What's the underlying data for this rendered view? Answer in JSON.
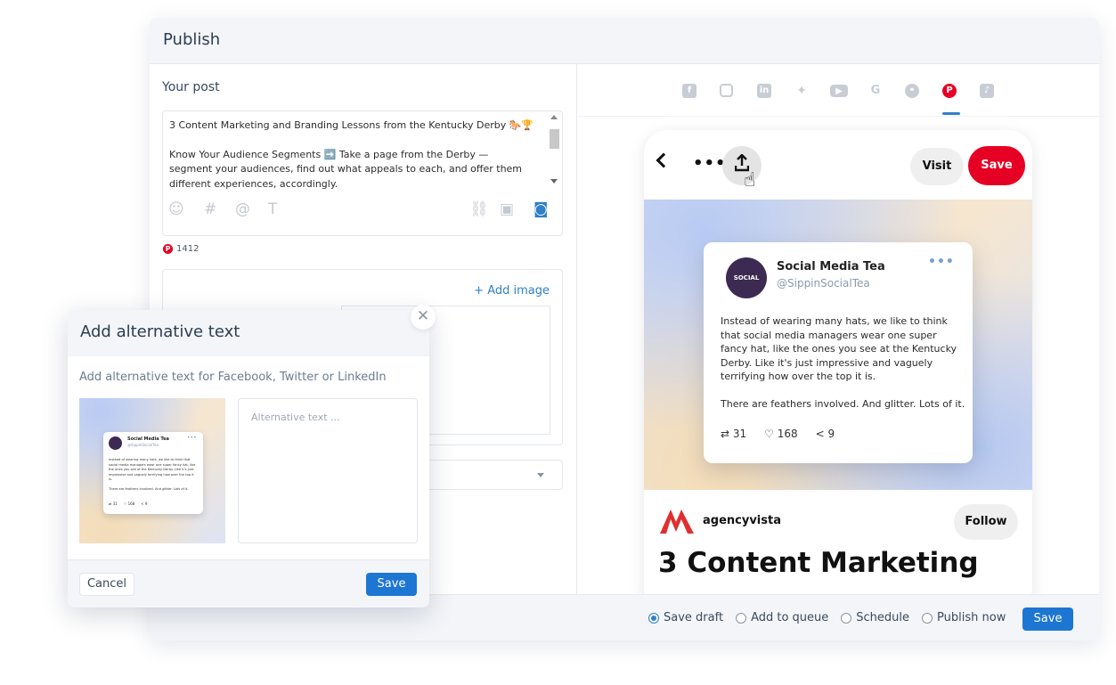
{
  "publish": {
    "title": "Publish",
    "your_post_label": "Your post",
    "editor": {
      "line1": "3 Content Marketing and Branding Lessons from the Kentucky Derby 🐎🏆",
      "line2": "Know Your Audience Segments ➡️ Take a page from the Derby — segment your audiences, find out what appeals to each, and offer them different experiences, accordingly.",
      "tools": [
        "emoji-icon",
        "hashtag-icon",
        "mention-icon",
        "text-format-icon",
        "link-icon",
        "video-icon",
        "camera-icon"
      ]
    },
    "pinterest_char_count": "1412",
    "add_image_label": "+ Add image"
  },
  "social_tabs": [
    "facebook-icon",
    "instagram-icon",
    "linkedin-icon",
    "twitter-icon",
    "youtube-icon",
    "google-icon",
    "reddit-icon",
    "pinterest-icon",
    "tiktok-icon"
  ],
  "active_social_tab": "pinterest-icon",
  "preview": {
    "visit_label": "Visit",
    "save_label": "Save",
    "tweet": {
      "avatar_text": "SOCIAL MEDIA TEA",
      "name": "Social Media Tea",
      "handle": "@SippinSocialTea",
      "para1": "Instead of wearing many hats, we like to think that social media managers wear one super fancy hat, like the ones you see at the Kentucky Derby. Like it's just impressive and vaguely terrifying how over the top it is.",
      "para2": "There are feathers involved. And glitter. Lots of it.",
      "retweets": "31",
      "likes": "168",
      "shares": "9"
    },
    "author": "agencyvista",
    "follow_label": "Follow",
    "headline": "3 Content Marketing"
  },
  "footer": {
    "options": [
      "Save draft",
      "Add to queue",
      "Schedule",
      "Publish now"
    ],
    "selected_option": "Save draft",
    "save_label": "Save"
  },
  "alt_dialog": {
    "title": "Add alternative text",
    "subtitle": "Add alternative text for Facebook, Twitter or LinkedIn",
    "placeholder": "Alternative text ...",
    "cancel_label": "Cancel",
    "save_label": "Save"
  },
  "colors": {
    "accent": "#1d76d2",
    "pinterest": "#e60023",
    "header_bg": "#f3f5f9"
  }
}
